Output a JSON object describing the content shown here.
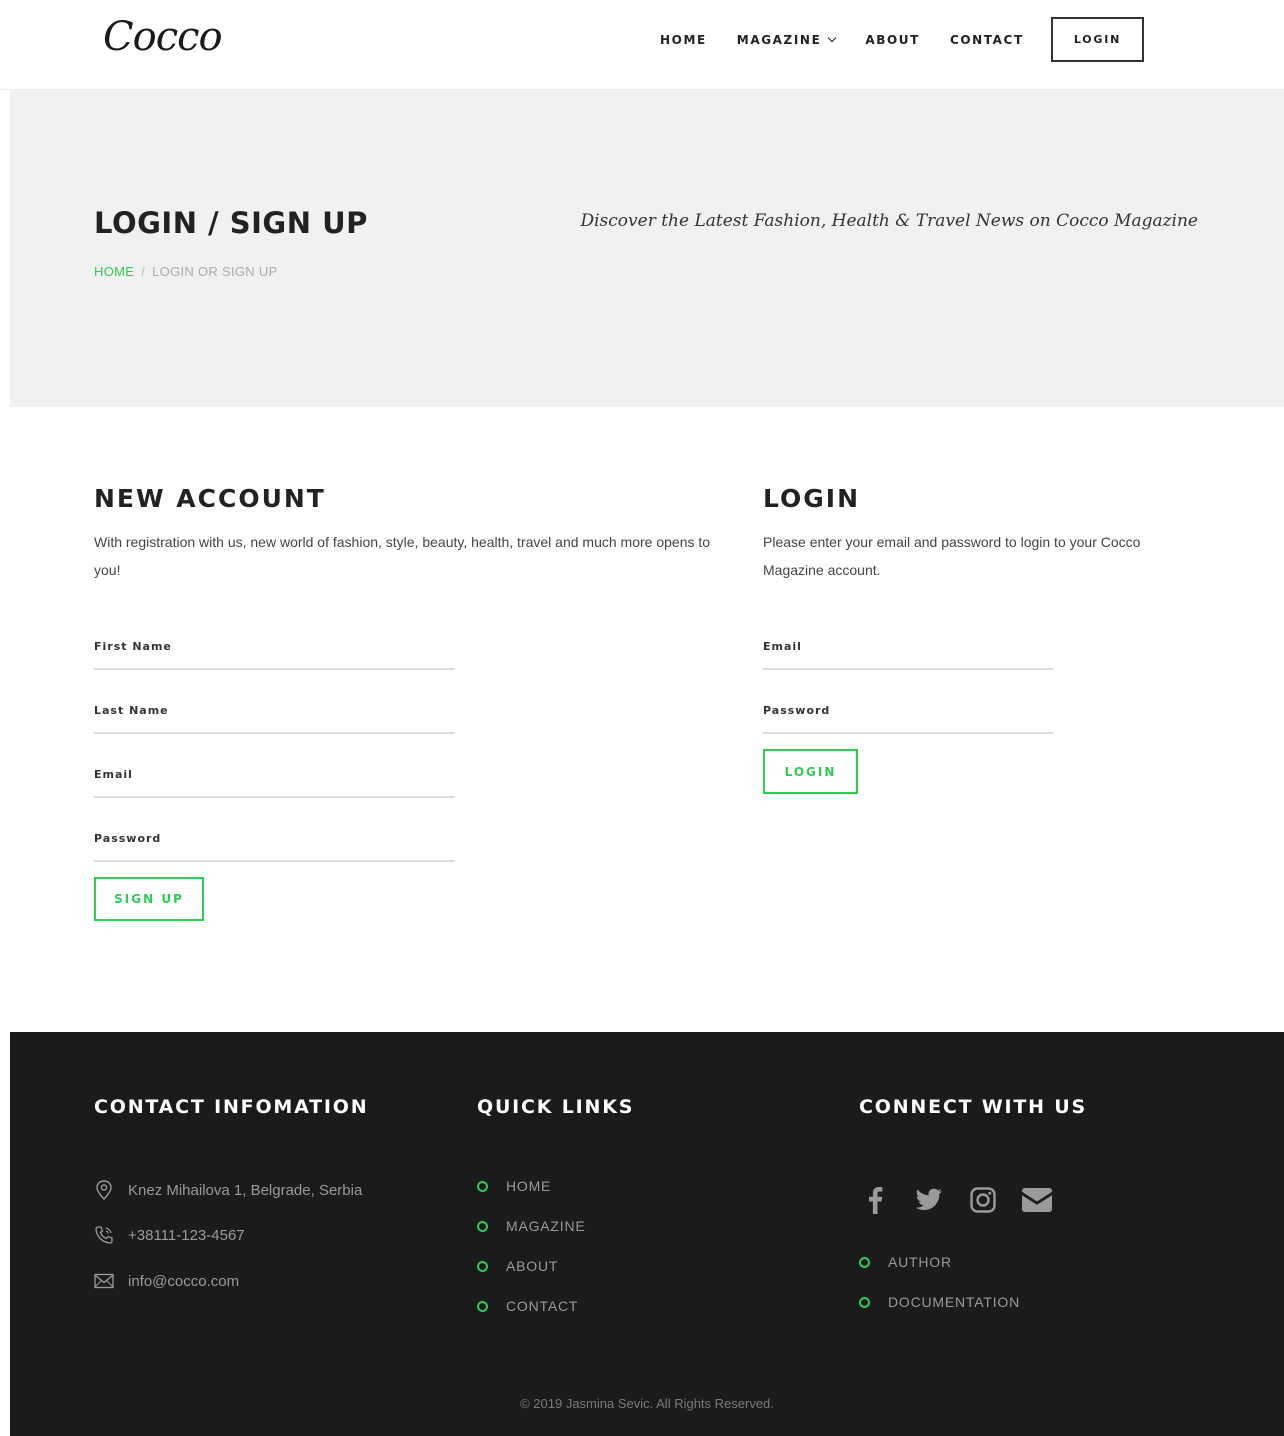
{
  "header": {
    "logo_text": "Cocco",
    "nav": [
      "HOME",
      "MAGAZINE",
      "ABOUT",
      "CONTACT"
    ],
    "login_label": "LOGIN"
  },
  "hero": {
    "title": "LOGIN / SIGN UP",
    "breadcrumb_home": "HOME",
    "breadcrumb_sep": "/",
    "breadcrumb_current": "LOGIN OR SIGN UP",
    "tagline": "Discover the Latest Fashion, Health & Travel News on Cocco Magazine"
  },
  "new_account": {
    "title": "NEW ACCOUNT",
    "description": "With registration with us, new world of fashion, style, beauty, health, travel and much more opens to you!",
    "fields": [
      "First Name",
      "Last Name",
      "Email",
      "Password"
    ],
    "button": "SIGN UP"
  },
  "login": {
    "title": "LOGIN",
    "description": "Please enter your email and password to login to your Cocco Magazine account.",
    "fields": [
      "Email",
      "Password"
    ],
    "button": "LOGIN"
  },
  "footer": {
    "contact_title": "CONTACT INFOMATION",
    "address": "Knez Mihailova 1, Belgrade, Serbia",
    "phone": "+38111-123-4567",
    "email": "info@cocco.com",
    "quick_title": "QUICK LINKS",
    "quick_links": [
      "HOME",
      "MAGAZINE",
      "ABOUT",
      "CONTACT"
    ],
    "connect_title": "CONNECT WITH US",
    "social_icons": [
      "facebook-icon",
      "twitter-icon",
      "instagram-icon",
      "envelope-icon"
    ],
    "connect_links": [
      "AUTHOR",
      "DOCUMENTATION"
    ],
    "copyright": "© 2019 Jasmina Sevic. All Rights Reserved."
  },
  "colors": {
    "accent": "#2ecc52",
    "footer_bg": "#1b1b1b",
    "hero_bg": "#f1f1f1"
  }
}
